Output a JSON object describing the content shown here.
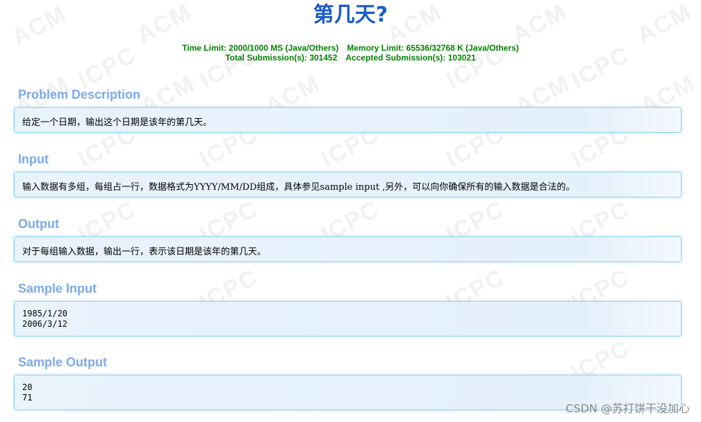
{
  "watermark": {
    "text_acm": "ACM",
    "text_icpc": "ICPC"
  },
  "problem": {
    "title": "第几天?",
    "time_limit": "Time Limit: 2000/1000 MS (Java/Others)",
    "memory_limit": "Memory Limit: 65536/32768 K (Java/Others)",
    "total_submissions": "Total Submission(s): 301452",
    "accepted_submissions": "Accepted Submission(s): 103021"
  },
  "sections": {
    "description": {
      "heading": "Problem Description",
      "body": "给定一个日期，输出这个日期是该年的第几天。"
    },
    "input": {
      "heading": "Input",
      "body": "输入数据有多组，每组占一行，数据格式为YYYY/MM/DD组成，具体参见sample input ,另外，可以向你确保所有的输入数据是合法的。"
    },
    "output": {
      "heading": "Output",
      "body": "对于每组输入数据，输出一行，表示该日期是该年的第几天。"
    },
    "sample_input": {
      "heading": "Sample Input",
      "lines": [
        "1985/1/20",
        "2006/3/12"
      ]
    },
    "sample_output": {
      "heading": "Sample Output",
      "lines": [
        "20",
        "71"
      ]
    }
  },
  "footer": {
    "credit": "CSDN @苏打饼干没加心"
  },
  "colors": {
    "title": "#1a5cc8",
    "limits": "#008000",
    "section_heading": "#7ca9ed",
    "panel_border": "#8ed3f0",
    "panel_bg": "#e6f1fb"
  }
}
